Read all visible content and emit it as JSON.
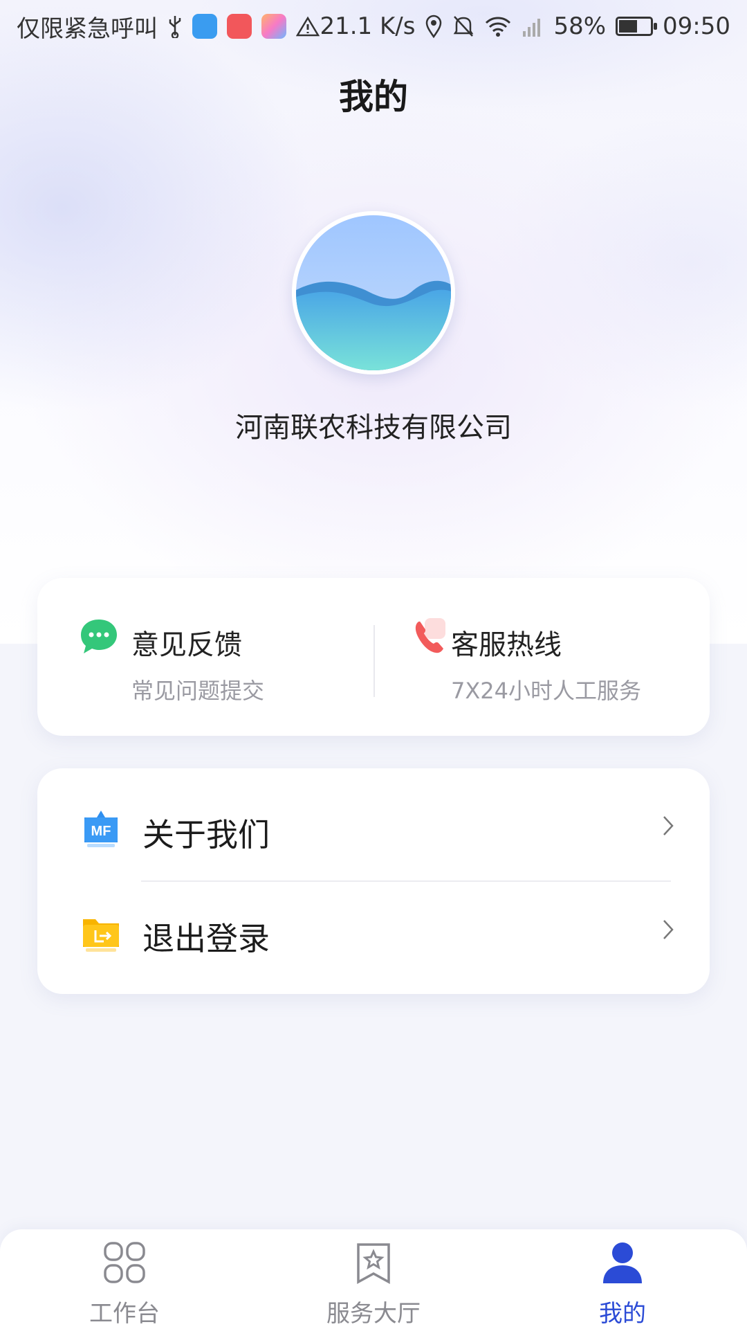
{
  "status_bar": {
    "carrier": "仅限紧急呼叫",
    "net_speed": "21.1 K/s",
    "battery": "58%",
    "battery_level": 0.58,
    "time": "09:50"
  },
  "header": {
    "title": "我的"
  },
  "profile": {
    "company": "河南联农科技有限公司"
  },
  "quick_actions": [
    {
      "title": "意见反馈",
      "subtitle": "常见问题提交",
      "icon": "chat-bubble-icon"
    },
    {
      "title": "客服热线",
      "subtitle": "7X24小时人工服务",
      "icon": "phone-icon"
    }
  ],
  "menu": [
    {
      "label": "关于我们",
      "icon": "mf-badge-icon"
    },
    {
      "label": "退出登录",
      "icon": "logout-folder-icon"
    }
  ],
  "tabs": [
    {
      "label": "工作台",
      "icon": "grid-icon",
      "active": false
    },
    {
      "label": "服务大厅",
      "icon": "bookmark-star-icon",
      "active": false
    },
    {
      "label": "我的",
      "icon": "user-icon",
      "active": true
    }
  ],
  "colors": {
    "accent": "#2b4bd6",
    "green": "#34c77a",
    "red": "#f25b5b",
    "orange": "#f8b400",
    "blue": "#2f8ff0"
  }
}
